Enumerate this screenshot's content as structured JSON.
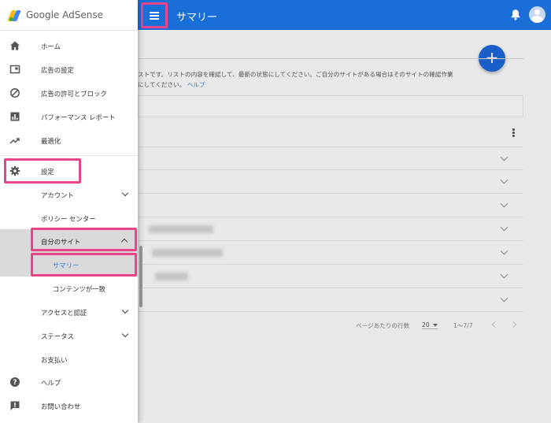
{
  "topbar": {
    "title": "サマリー",
    "bell_icon": "bell-icon",
    "avatar_icon": "account-icon"
  },
  "brand": {
    "name": "Google AdSense"
  },
  "nav": {
    "home": "ホーム",
    "ad_settings": "広告の設定",
    "allow_block": "広告の許可とブロック",
    "performance": "パフォーマンス レポート",
    "optimize": "最適化",
    "settings": "設定",
    "account": "アカウント",
    "policy_center": "ポリシー センター",
    "my_sites": "自分のサイト",
    "summary": "サマリー",
    "content_match": "コンテンツが一致",
    "access": "アクセスと認証",
    "status": "ステータス",
    "payments": "お支払い",
    "help": "ヘルプ",
    "contact": "お問い合わせ"
  },
  "content": {
    "intro_line1": "ストです。リストの内容を確認して、最新の状態にしてください。ご自分のサイトがある場合はそのサイトの確認作業",
    "intro_line2": "にしてください。",
    "intro_help": "ヘルプ",
    "pager_label": "ページあたりの行数",
    "pager_value": "20",
    "pager_range": "1～7/7"
  },
  "colors": {
    "topbar": "#1a6ed8",
    "accent": "#3f7ad3",
    "highlight": "#e8458b"
  }
}
